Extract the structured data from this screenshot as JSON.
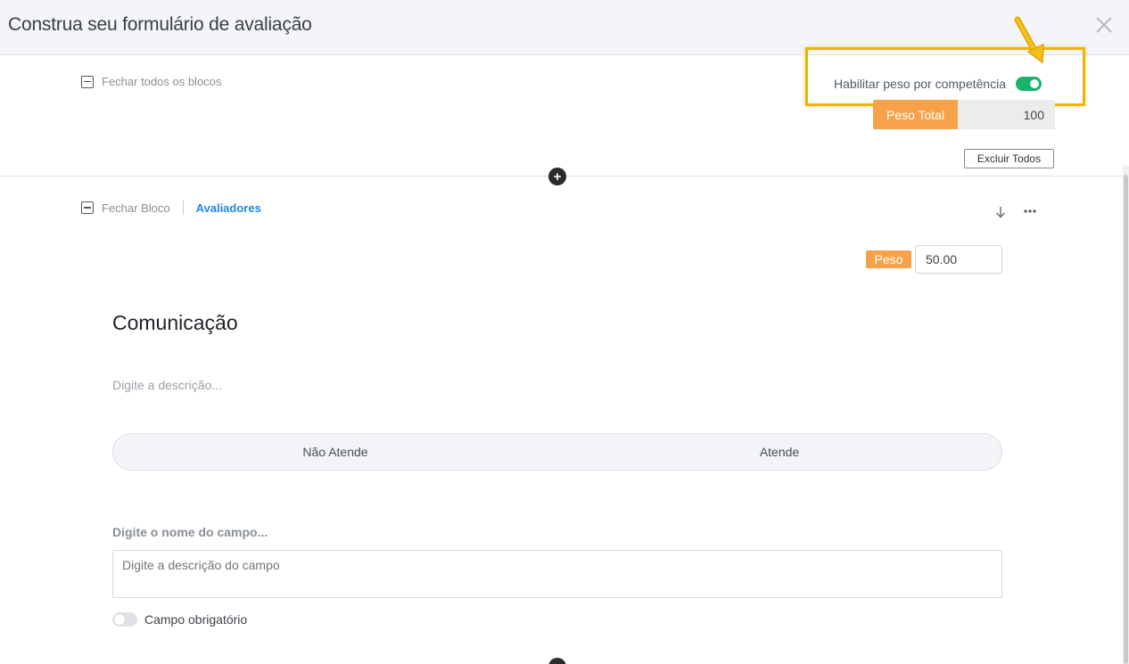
{
  "header": {
    "title": "Construa seu formulário de avaliação"
  },
  "toolbar": {
    "collapse_all_label": "Fechar todos os blocos",
    "weight_toggle_label": "Habilitar peso por competência",
    "weight_toggle_on": true,
    "total_weight_label": "Peso Total",
    "total_weight_value": "100",
    "delete_all_label": "Excluir Todos"
  },
  "block": {
    "collapse_label": "Fechar Bloco",
    "evaluators_link": "Avaliadores",
    "weight_label": "Peso",
    "weight_value": "50.00",
    "competency_title": "Comunicação",
    "description_placeholder": "Digite a descrição...",
    "scale_options": [
      "Não Atende",
      "Atende"
    ],
    "field_name_placeholder": "Digite o nome do campo...",
    "field_description_placeholder": "Digite a descrição do campo",
    "required_label": "Campo obrigatório",
    "required_on": false
  },
  "colors": {
    "highlight": "#f0b400",
    "toggle_on": "#19b36b",
    "weight_tag": "#f6a24a",
    "link": "#1e88e5"
  },
  "icons": [
    "close-icon",
    "collapse-icon",
    "add-block-icon",
    "arrow-down-icon",
    "more-options-icon",
    "annotation-arrow-icon"
  ]
}
